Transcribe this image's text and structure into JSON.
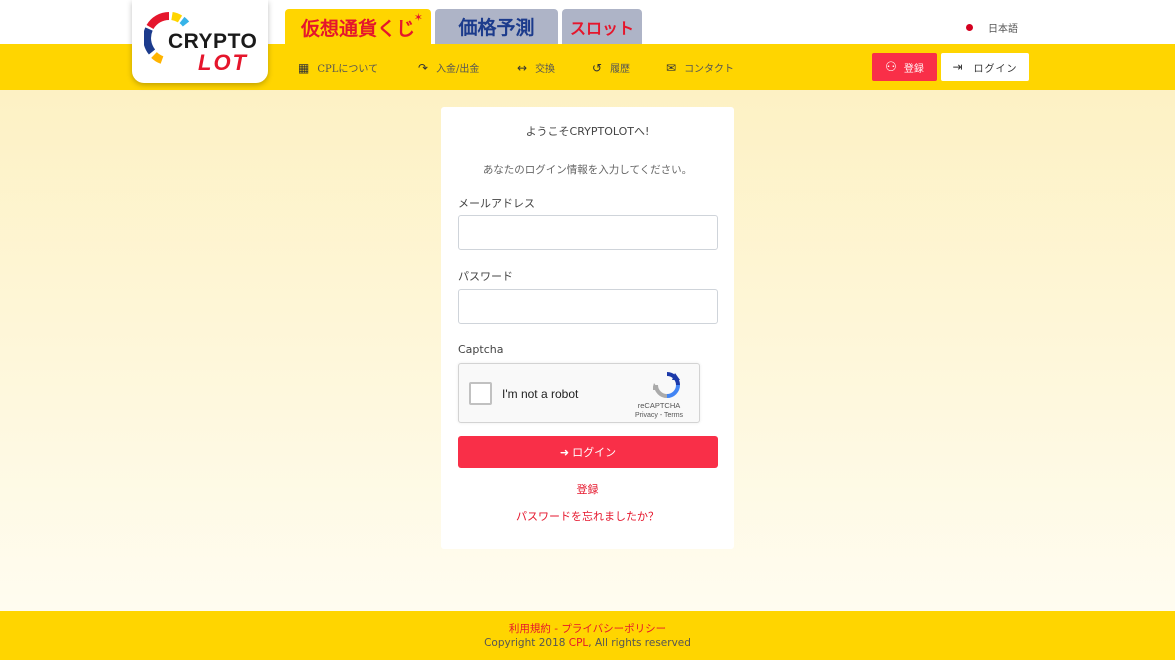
{
  "header": {
    "logo": {
      "line1": "CRYPTO",
      "line2": "LOT"
    },
    "tabs": [
      {
        "label": "仮想通貨くじ",
        "active": true
      },
      {
        "label": "価格予測",
        "active": false
      },
      {
        "label": "スロット",
        "active": false
      }
    ],
    "language": "日本語"
  },
  "nav": {
    "items": [
      {
        "label": "CPLについて",
        "icon": "building-icon"
      },
      {
        "label": "入金/出金",
        "icon": "redo-arrow-icon"
      },
      {
        "label": "交換",
        "icon": "exchange-icon"
      },
      {
        "label": "履歴",
        "icon": "history-icon"
      },
      {
        "label": "コンタクト",
        "icon": "mail-icon"
      }
    ],
    "register_label": "登録",
    "login_label": "ログイン"
  },
  "login": {
    "title": "ようこそCRYPTOLOTへ!",
    "subtitle": "あなたのログイン情報を入力してください。",
    "email_label": "メールアドレス",
    "email_value": "",
    "password_label": "パスワード",
    "password_value": "",
    "captcha_label": "Captcha",
    "captcha": {
      "checkbox_text": "I'm not a robot",
      "brand": "reCAPTCHA",
      "links": "Privacy - Terms"
    },
    "submit_label": "ログイン",
    "register_link": "登録",
    "forgot_link": "パスワードを忘れましたか？"
  },
  "footer": {
    "links": "利用規約 - プライバシーポリシー",
    "copyright_prefix": "Copyright 2018 ",
    "copyright_brand": "CPL",
    "copyright_suffix": ", All rights reserved"
  },
  "colors": {
    "brand_yellow": "#ffd500",
    "accent_red": "#f92f48",
    "tab_gray": "#aeb4c7",
    "predict_blue": "#1c3b8c"
  }
}
